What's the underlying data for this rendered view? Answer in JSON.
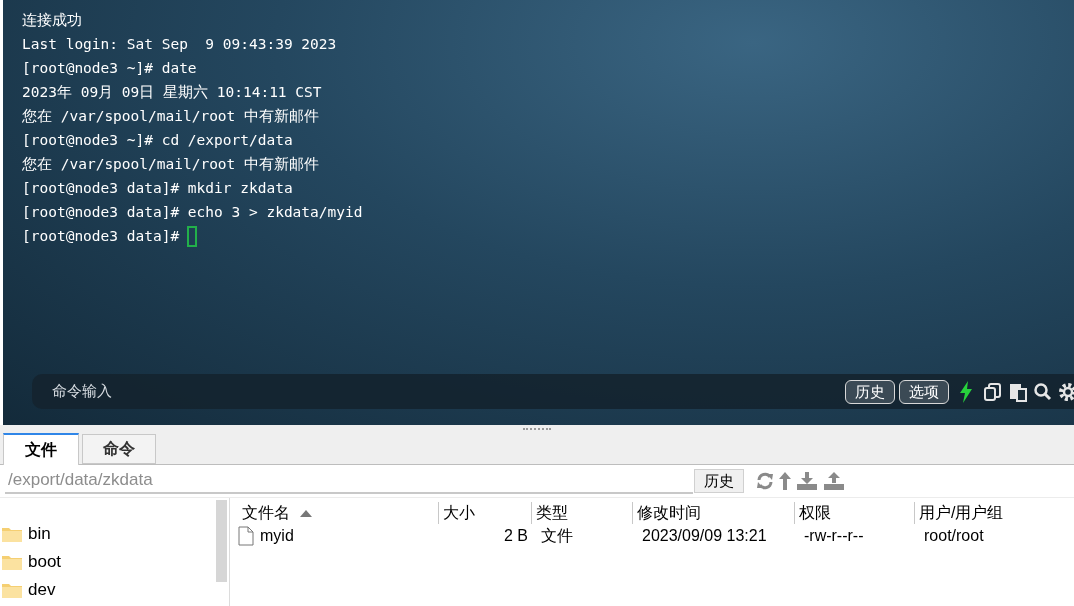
{
  "terminal": {
    "lines": [
      "连接成功",
      "Last login: Sat Sep  9 09:43:39 2023",
      "[root@node3 ~]# date",
      "2023年 09月 09日 星期六 10:14:11 CST",
      "您在 /var/spool/mail/root 中有新邮件",
      "[root@node3 ~]# cd /export/data",
      "您在 /var/spool/mail/root 中有新邮件",
      "[root@node3 data]# mkdir zkdata",
      "[root@node3 data]# echo 3 > zkdata/myid"
    ],
    "prompt": "[root@node3 data]#"
  },
  "command_bar": {
    "placeholder": "命令输入",
    "buttons": [
      "历史",
      "选项"
    ]
  },
  "tabs": [
    {
      "label": "文件",
      "selected": true
    },
    {
      "label": "命令",
      "selected": false
    }
  ],
  "path_bar": {
    "value": "/export/data/zkdata",
    "button": "历史"
  },
  "tree": {
    "items": [
      "bin",
      "boot",
      "dev"
    ]
  },
  "table": {
    "columns": [
      {
        "label": "文件名",
        "sorted": true
      },
      {
        "label": "大小"
      },
      {
        "label": "类型"
      },
      {
        "label": "修改时间"
      },
      {
        "label": "权限"
      },
      {
        "label": "用户/用户组"
      }
    ],
    "rows": [
      {
        "name": "myid",
        "size": "2 B",
        "type": "文件",
        "modified": "2023/09/09 13:21",
        "permissions": "-rw-r--r--",
        "owner": "root/root"
      }
    ]
  }
}
